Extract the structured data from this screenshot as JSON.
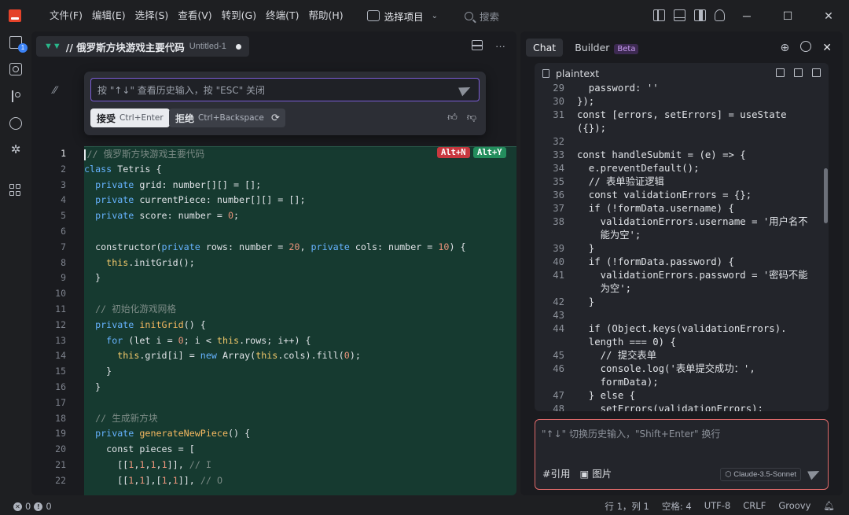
{
  "menu": [
    "文件(F)",
    "编辑(E)",
    "选择(S)",
    "查看(V)",
    "转到(G)",
    "终端(T)",
    "帮助(H)"
  ],
  "project_selector": "选择项目",
  "search_placeholder": "搜索",
  "files_badge": "1",
  "tab": {
    "title": "// 俄罗斯方块游戏主要代码",
    "subtitle": "Untitled-1"
  },
  "inline_prompt": {
    "placeholder": "按 \"↑↓\" 查看历史输入，按 \"ESC\" 关闭",
    "accept_label": "接受",
    "accept_shortcut": "Ctrl+Enter",
    "reject_label": "拒绝",
    "reject_shortcut": "Ctrl+Backspace"
  },
  "diff_badges": {
    "reject": "Alt+N",
    "accept": "Alt+Y"
  },
  "line_numbers": [
    "1",
    "2",
    "3",
    "4",
    "5",
    "6",
    "7",
    "8",
    "9",
    "10",
    "11",
    "12",
    "13",
    "14",
    "15",
    "16",
    "17",
    "18",
    "19",
    "20",
    "21",
    "22"
  ],
  "chat": {
    "tab_chat": "Chat",
    "tab_builder": "Builder",
    "beta": "Beta",
    "codeblock_lang": "plaintext",
    "code_lines": [
      {
        "n": "29",
        "t": "  password: ''"
      },
      {
        "n": "30",
        "t": "});"
      },
      {
        "n": "31",
        "t": "const [errors, setErrors] = useState"
      },
      {
        "n": "",
        "t": "({});"
      },
      {
        "n": "32",
        "t": ""
      },
      {
        "n": "33",
        "t": "const handleSubmit = (e) => {"
      },
      {
        "n": "34",
        "t": "  e.preventDefault();"
      },
      {
        "n": "35",
        "t": "  // 表单验证逻辑"
      },
      {
        "n": "36",
        "t": "  const validationErrors = {};"
      },
      {
        "n": "37",
        "t": "  if (!formData.username) {"
      },
      {
        "n": "38",
        "t": "    validationErrors.username = '用户名不"
      },
      {
        "n": "",
        "t": "    能为空';"
      },
      {
        "n": "39",
        "t": "  }"
      },
      {
        "n": "40",
        "t": "  if (!formData.password) {"
      },
      {
        "n": "41",
        "t": "    validationErrors.password = '密码不能"
      },
      {
        "n": "",
        "t": "    为空';"
      },
      {
        "n": "42",
        "t": "  }"
      },
      {
        "n": "43",
        "t": ""
      },
      {
        "n": "44",
        "t": "  if (Object.keys(validationErrors)."
      },
      {
        "n": "",
        "t": "  length === 0) {"
      },
      {
        "n": "45",
        "t": "    // 提交表单"
      },
      {
        "n": "46",
        "t": "    console.log('表单提交成功：',"
      },
      {
        "n": "",
        "t": "    formData);"
      },
      {
        "n": "47",
        "t": "  } else {"
      },
      {
        "n": "48",
        "t": "    setErrors(validationErrors);"
      }
    ],
    "input_placeholder": "\"↑↓\" 切换历史输入，\"Shift+Enter\" 换行",
    "cite_label": "#引用",
    "image_label": "图片",
    "model": "Claude-3.5-Sonnet"
  },
  "status": {
    "errors": "0",
    "warnings": "0",
    "position": "行 1，列 1",
    "spaces": "空格: 4",
    "encoding": "UTF-8",
    "eol": "CRLF",
    "language": "Groovy"
  }
}
